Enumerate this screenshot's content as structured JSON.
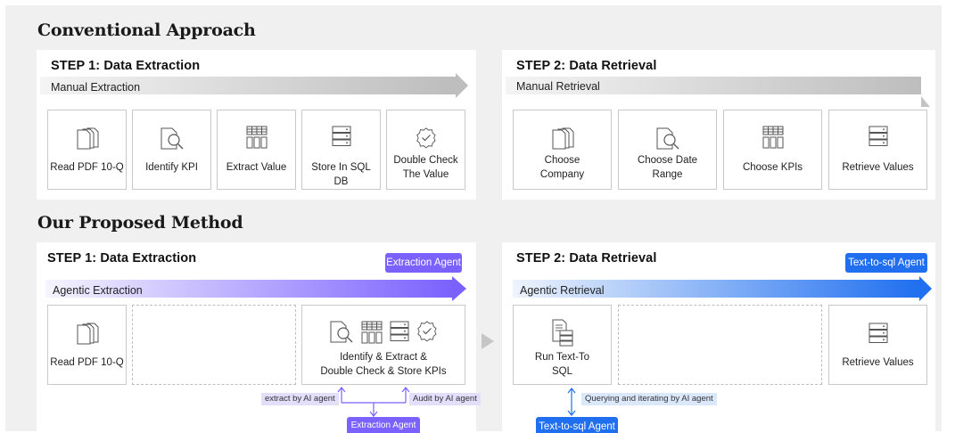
{
  "conventional": {
    "title": "Conventional Approach",
    "step1": {
      "title": "STEP 1: Data Extraction",
      "arrow_label": "Manual Extraction",
      "boxes": [
        {
          "label": "Read PDF 10-Q",
          "icon": "documents-icon"
        },
        {
          "label": "Identify KPI",
          "icon": "document-search-icon"
        },
        {
          "label": "Extract Value",
          "icon": "table-icon"
        },
        {
          "label": "Store In SQL DB",
          "icon": "database-icon"
        },
        {
          "label": "Double Check\nThe Value",
          "icon": "verified-badge-icon"
        }
      ]
    },
    "step2": {
      "title": "STEP 2: Data Retrieval",
      "arrow_label": "Manual Retrieval",
      "boxes": [
        {
          "label": "Choose\nCompany",
          "icon": "documents-icon"
        },
        {
          "label": "Choose Date\nRange",
          "icon": "document-search-icon"
        },
        {
          "label": "Choose KPIs",
          "icon": "table-icon"
        },
        {
          "label": "Retrieve Values",
          "icon": "database-icon"
        }
      ]
    }
  },
  "proposed": {
    "title": "Our Proposed Method",
    "step1": {
      "title": "STEP 1: Data Extraction",
      "badge": "Extraction Agent",
      "arrow_label": "Agentic Extraction",
      "box_read": "Read PDF 10-Q",
      "box_combined": "Identify & Extract &\nDouble Check & Store KPIs",
      "note_left": "extract by AI agent",
      "note_right": "Audit by AI agent",
      "bottom_badge": "Extraction Agent"
    },
    "step2": {
      "title": "STEP 2: Data Retrieval",
      "badge": "Text-to-sql Agent",
      "arrow_label": "Agentic Retrieval",
      "box_run": "Run Text-To\nSQL",
      "box_retrieve": "Retrieve Values",
      "note": "Querying and iterating by AI agent",
      "bottom_badge": "Text-to-sql Agent"
    }
  },
  "colors": {
    "purple": "#7b61ff",
    "purple_light": "#e3defb",
    "blue": "#1f6ff0",
    "blue_light": "#dbe8fb",
    "gray_arrow": "#c8c8c8"
  }
}
